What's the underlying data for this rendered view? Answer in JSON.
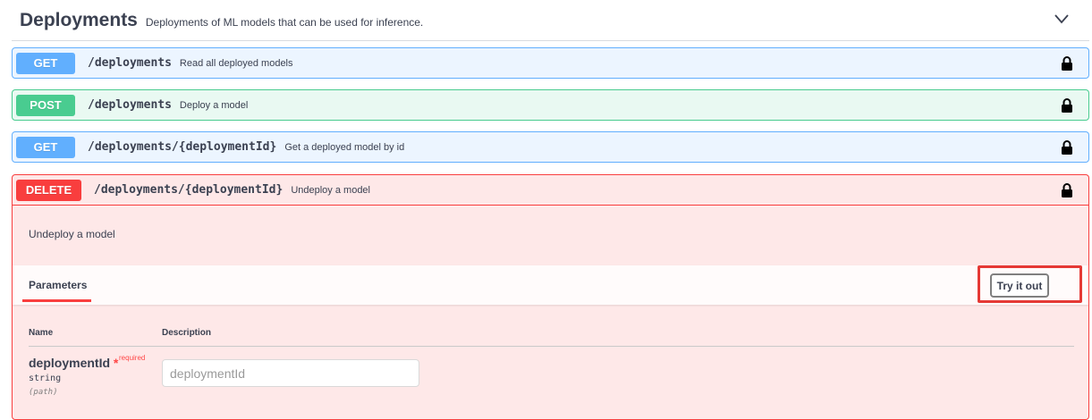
{
  "tag": {
    "title": "Deployments",
    "description": "Deployments of ML models that can be used for inference."
  },
  "operations": [
    {
      "method": "GET",
      "path": "/deployments",
      "summary": "Read all deployed models"
    },
    {
      "method": "POST",
      "path": "/deployments",
      "summary": "Deploy a model"
    },
    {
      "method": "GET",
      "path": "/deployments/{deploymentId}",
      "summary": "Get a deployed model by id"
    },
    {
      "method": "DELETE",
      "path": "/deployments/{deploymentId}",
      "summary": "Undeploy a model"
    }
  ],
  "expanded": {
    "description": "Undeploy a model",
    "parameters_tab": "Parameters",
    "try_it_out_label": "Try it out",
    "columns": {
      "name": "Name",
      "description": "Description"
    },
    "param": {
      "name": "deploymentId",
      "required_star": "*",
      "required_label": "required",
      "type": "string",
      "in": "(path)",
      "placeholder": "deploymentId"
    }
  },
  "colors": {
    "get": "#61affe",
    "post": "#49cc90",
    "delete": "#f93e3e",
    "highlight": "#e53935"
  },
  "icons": {
    "lock": "lock-icon",
    "chevron": "chevron-down-icon"
  }
}
